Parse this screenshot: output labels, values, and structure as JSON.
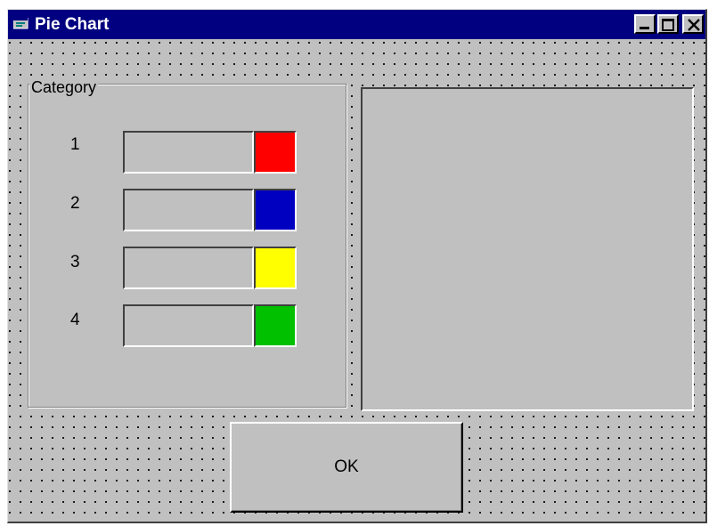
{
  "window": {
    "title": "Pie Chart",
    "icon": "form-icon",
    "controls": {
      "minimize": "minimize-icon",
      "maximize": "maximize-icon",
      "close": "close-icon"
    }
  },
  "category_frame": {
    "label": "Category",
    "rows": [
      {
        "number": "1",
        "value": "",
        "color": "#ff0000"
      },
      {
        "number": "2",
        "value": "",
        "color": "#0000c0"
      },
      {
        "number": "3",
        "value": "",
        "color": "#ffff00"
      },
      {
        "number": "4",
        "value": "",
        "color": "#00c000"
      }
    ]
  },
  "buttons": {
    "ok": "OK"
  },
  "colors": {
    "titlebar": "#000080",
    "face": "#c0c0c0"
  }
}
